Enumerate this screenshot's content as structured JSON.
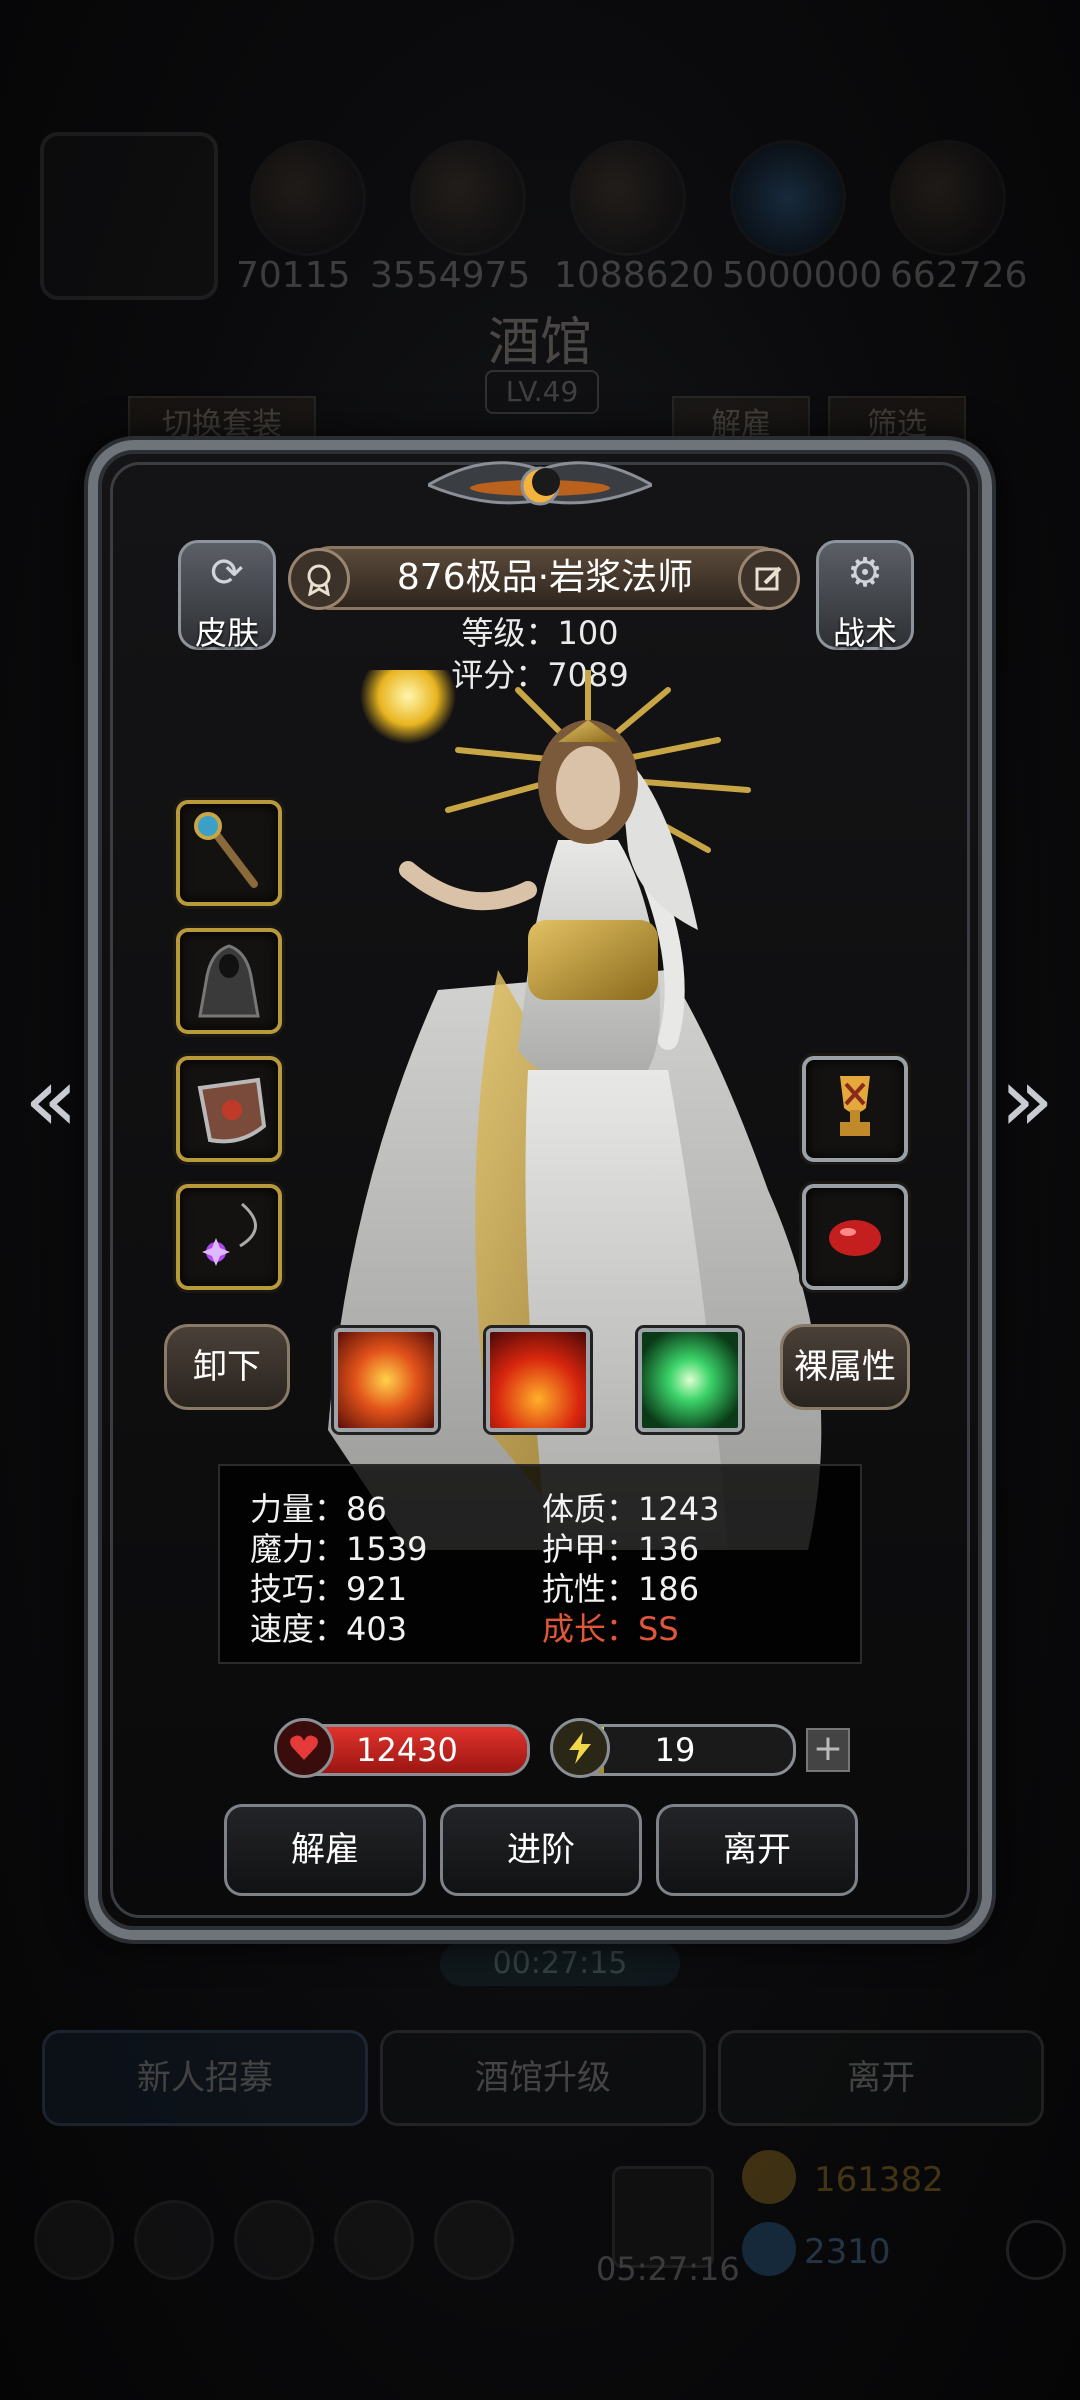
{
  "background": {
    "resources": [
      "70115",
      "3554975",
      "1088620",
      "5000000",
      "662726"
    ],
    "tavern_title": "酒馆",
    "tavern_level": "LV.49",
    "switch_set_label": "切换套装",
    "dismiss_label": "解雇",
    "filter_label": "筛选",
    "timer": "00:27:15",
    "bottom_buttons": [
      "新人招募",
      "酒馆升级",
      "离开"
    ],
    "dock_timer": "05:27:16",
    "gold_amount": "161382",
    "gem_amount": "2310"
  },
  "hero": {
    "name": "876极品·岩浆法师",
    "level_line": "等级：100",
    "score_line": "评分：7089",
    "skin_label": "皮肤",
    "tactics_label": "战术"
  },
  "equipment": {
    "left_slots": [
      "staff-icon",
      "cloak-icon",
      "shield-icon",
      "amulet-icon"
    ],
    "right_slots": [
      "trophy-icon",
      "red-gem-icon"
    ]
  },
  "skills": {
    "unequip_label": "卸下",
    "raw_attributes_label": "裸属性",
    "icons": [
      "fire-burst-icon",
      "flame-icon",
      "green-light-icon"
    ]
  },
  "attributes": {
    "strength": "力量：86",
    "magic": "魔力：1539",
    "skill": "技巧：921",
    "speed": "速度：403",
    "constitution": "体质：1243",
    "armor": "护甲：136",
    "resistance": "抗性：186",
    "growth": "成长：SS"
  },
  "bars": {
    "hp_value": "12430",
    "hp_fraction": 1.0,
    "energy_value": "19",
    "energy_fraction": 0.2
  },
  "actions": {
    "dismiss": "解雇",
    "advance": "进阶",
    "leave": "离开"
  },
  "colors": {
    "gold_frame": "#b8993c",
    "growth_text": "#e2563a",
    "hp_red": "#e0332d",
    "energy_yellow": "#f0d84a"
  }
}
